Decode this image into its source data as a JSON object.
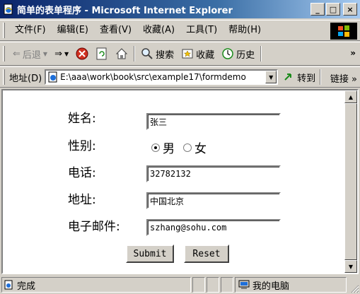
{
  "window": {
    "title": "简单的表单程序 - Microsoft Internet Explorer",
    "minimize": "_",
    "maximize": "□",
    "close": "×"
  },
  "menu": {
    "items": [
      "文件(F)",
      "编辑(E)",
      "查看(V)",
      "收藏(A)",
      "工具(T)",
      "帮助(H)"
    ]
  },
  "toolbar": {
    "back": "后退",
    "search": "搜索",
    "favorites": "收藏",
    "history": "历史",
    "more": "»"
  },
  "address": {
    "label": "地址(D)",
    "value": "E:\\aaa\\work\\book\\src\\example17\\formdemo",
    "go": "转到",
    "links": "链接 »"
  },
  "form": {
    "name_label": "姓名:",
    "name_value": "张三",
    "gender_label": "性别:",
    "gender_male": "男",
    "gender_female": "女",
    "gender_selected": "男",
    "phone_label": "电话:",
    "phone_value": "32782132",
    "address_label": "地址:",
    "address_value": "中国北京",
    "email_label": "电子邮件:",
    "email_value": "szhang@sohu.com",
    "submit": "Submit",
    "reset": "Reset"
  },
  "status": {
    "text": "完成",
    "zone": "我的电脑"
  },
  "colors": {
    "title_start": "#0a246a",
    "title_end": "#a6caf0",
    "chrome": "#d4d0c8"
  }
}
